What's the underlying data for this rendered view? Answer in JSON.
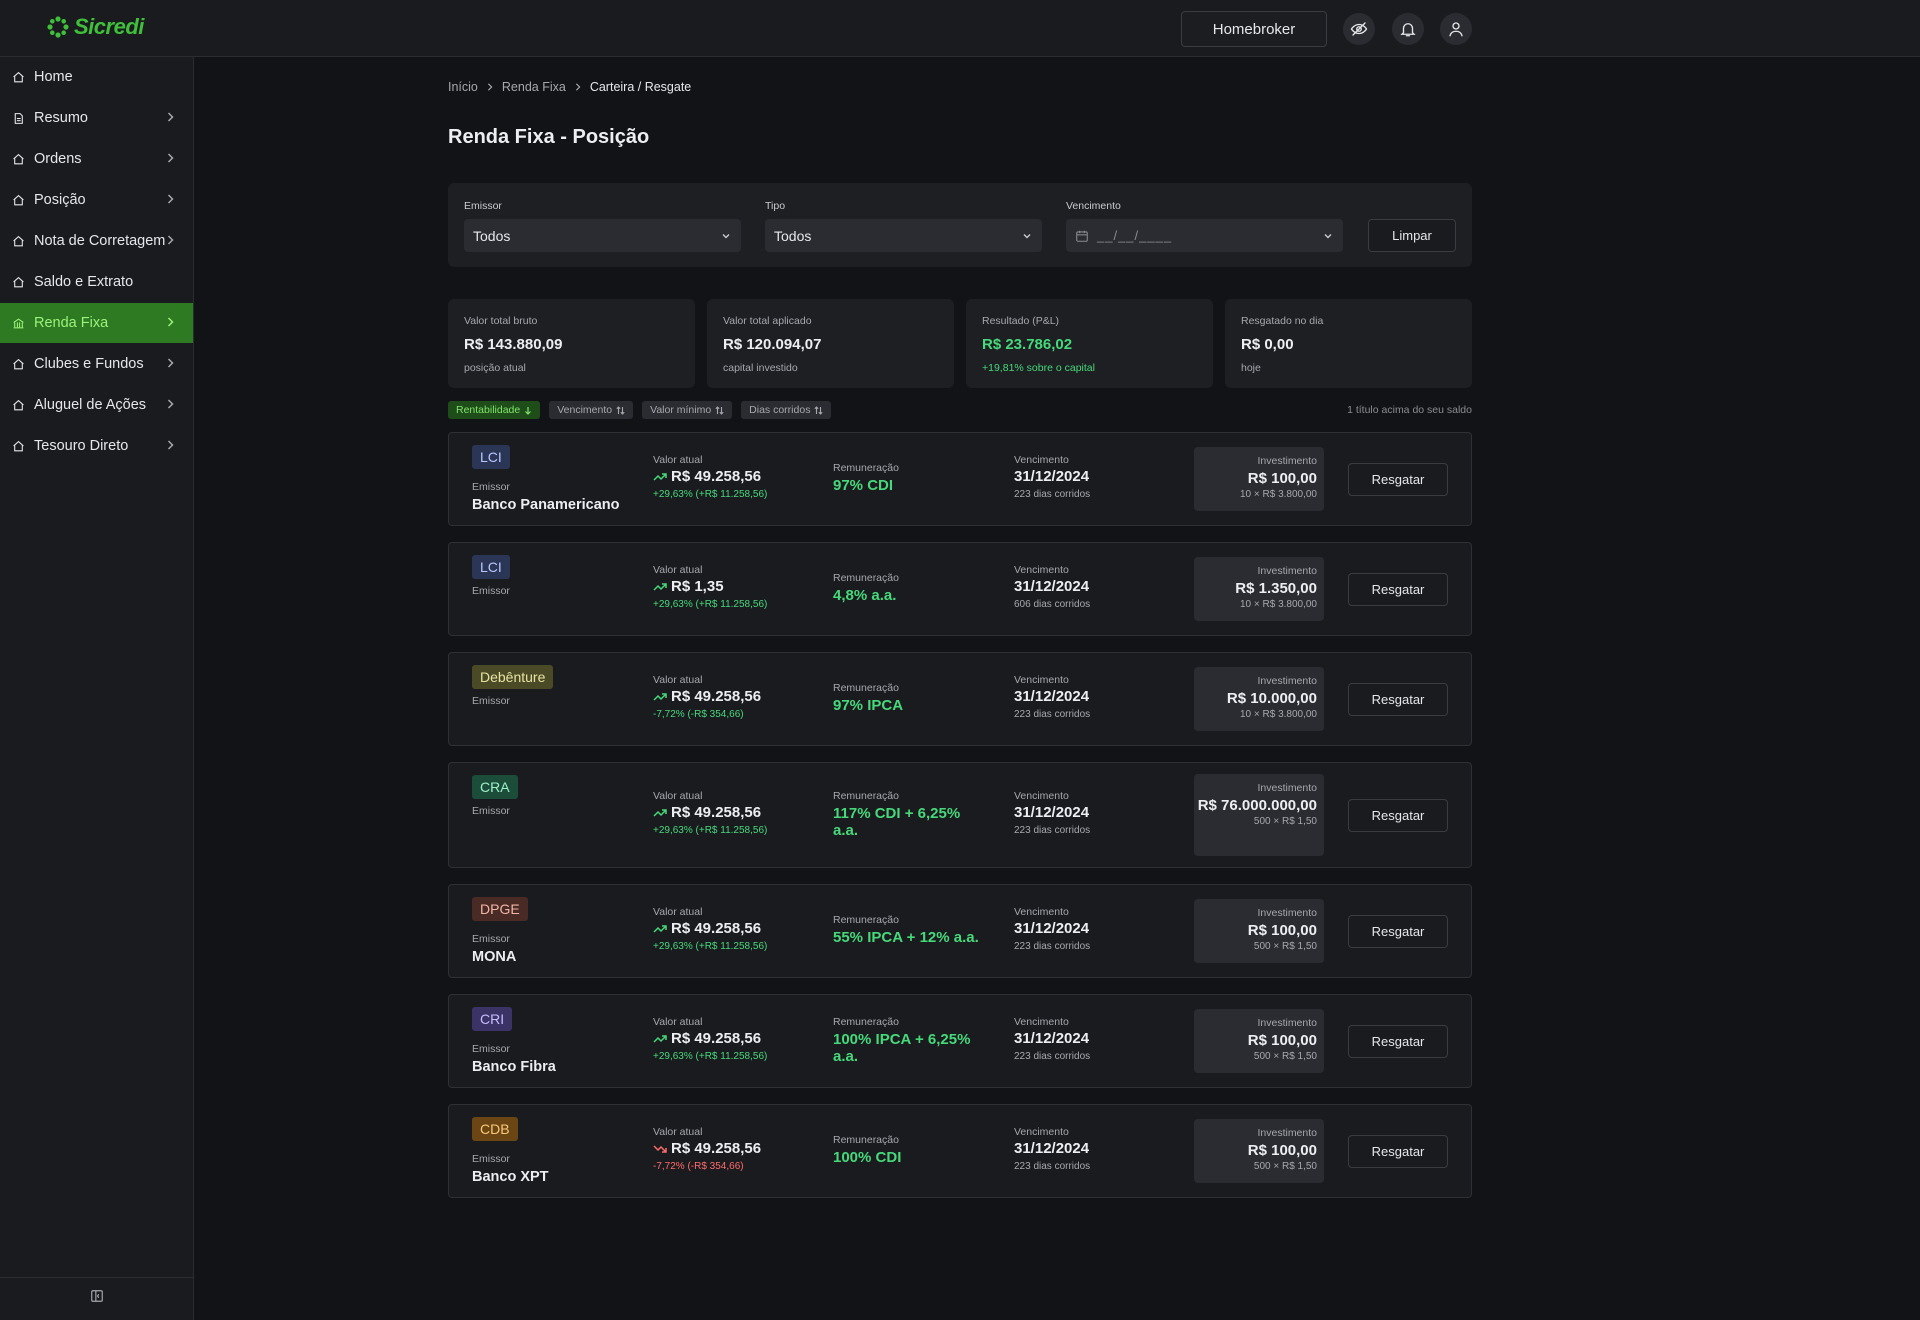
{
  "header": {
    "logo_text": "Sicredi",
    "homebroker_label": "Homebroker",
    "icons": [
      "eye-off-icon",
      "bell-icon",
      "user-icon"
    ]
  },
  "sidebar": {
    "items": [
      {
        "label": "Home",
        "has_chevron": false,
        "active": false,
        "icon": "home-icon"
      },
      {
        "label": "Resumo",
        "has_chevron": true,
        "active": false,
        "icon": "document-icon"
      },
      {
        "label": "Ordens",
        "has_chevron": true,
        "active": false,
        "icon": "home-icon"
      },
      {
        "label": "Posição",
        "has_chevron": true,
        "active": false,
        "icon": "home-icon"
      },
      {
        "label": "Nota de Corretagem",
        "has_chevron": true,
        "active": false,
        "icon": "home-icon"
      },
      {
        "label": "Saldo e Extrato",
        "has_chevron": false,
        "active": false,
        "icon": "home-icon"
      },
      {
        "label": "Renda Fixa",
        "has_chevron": true,
        "active": true,
        "icon": "bank-icon"
      },
      {
        "label": "Clubes e Fundos",
        "has_chevron": true,
        "active": false,
        "icon": "home-icon"
      },
      {
        "label": "Aluguel de Ações",
        "has_chevron": true,
        "active": false,
        "icon": "home-icon"
      },
      {
        "label": "Tesouro Direto",
        "has_chevron": true,
        "active": false,
        "icon": "home-icon"
      }
    ]
  },
  "breadcrumb": [
    "Início",
    "Renda Fixa",
    "Carteira / Resgate"
  ],
  "page_title": "Renda Fixa - Posição",
  "filters": {
    "emissor": {
      "label": "Emissor",
      "value": "Todos"
    },
    "tipo": {
      "label": "Tipo",
      "value": "Todos"
    },
    "vencimento": {
      "label": "Vencimento",
      "placeholder": "__/__/____"
    },
    "clear_label": "Limpar"
  },
  "stats": [
    {
      "label": "Valor total bruto",
      "value": "R$ 143.880,09",
      "sub": "posição atual",
      "positive": false
    },
    {
      "label": "Valor total aplicado",
      "value": "R$ 120.094,07",
      "sub": "capital investido",
      "positive": false
    },
    {
      "label": "Resultado (P&L)",
      "value": "R$ 23.786,02",
      "sub": "+19,81% sobre o capital",
      "positive": true
    },
    {
      "label": "Resgatado no dia",
      "value": "R$ 0,00",
      "sub": "hoje",
      "positive": false
    }
  ],
  "sort": {
    "chips": [
      {
        "label": "Rentabilidade",
        "active": true
      },
      {
        "label": "Vencimento",
        "active": false
      },
      {
        "label": "Valor mínimo",
        "active": false
      },
      {
        "label": "Dias corridos",
        "active": false
      }
    ],
    "note": "1 título acima do seu saldo"
  },
  "column_labels": {
    "emissor": "Emissor",
    "valor_atual": "Valor atual",
    "remuneracao": "Remuneração",
    "vencimento": "Vencimento",
    "investimento": "Investimento",
    "action": "Resgatar"
  },
  "positions": [
    {
      "type": "LCI",
      "type_class": "lci",
      "emissor": "Banco Panamericano",
      "valor": "R$ 49.258,56",
      "trend": "up",
      "change": "+29,63% (+R$ 11.258,56)",
      "remuneracao": "97% CDI",
      "vencimento": "31/12/2024",
      "dias": "223 dias corridos",
      "investimento": "R$ 100,00",
      "qty": "10 × R$ 3.800,00"
    },
    {
      "type": "LCI",
      "type_class": "lci",
      "emissor": "",
      "valor": "R$ 1,35",
      "trend": "up",
      "change": "+29,63% (+R$ 11.258,56)",
      "remuneracao": "4,8% a.a.",
      "vencimento": "31/12/2024",
      "dias": "606 dias corridos",
      "investimento": "R$ 1.350,00",
      "qty": "10 × R$ 3.800,00"
    },
    {
      "type": "Debênture",
      "type_class": "deb",
      "emissor": "",
      "valor": "R$ 49.258,56",
      "trend": "up",
      "change": "-7,72% (-R$ 354,66)",
      "change_color": "pos",
      "remuneracao": "97% IPCA",
      "vencimento": "31/12/2024",
      "dias": "223 dias corridos",
      "investimento": "R$ 10.000,00",
      "qty": "10 × R$ 3.800,00"
    },
    {
      "type": "CRA",
      "type_class": "cra",
      "emissor": "",
      "valor": "R$ 49.258,56",
      "trend": "up",
      "change": "+29,63% (+R$ 11.258,56)",
      "remuneracao": "117% CDI + 6,25% a.a.",
      "vencimento": "31/12/2024",
      "dias": "223 dias corridos",
      "investimento": "R$ 76.000.000,00",
      "qty": "500 × R$ 1,50"
    },
    {
      "type": "DPGE",
      "type_class": "dpge",
      "emissor": "MONA",
      "valor": "R$ 49.258,56",
      "trend": "up",
      "change": "+29,63% (+R$ 11.258,56)",
      "remuneracao": "55% IPCA + 12% a.a.",
      "vencimento": "31/12/2024",
      "dias": "223 dias corridos",
      "investimento": "R$ 100,00",
      "qty": "500 × R$ 1,50"
    },
    {
      "type": "CRI",
      "type_class": "cri",
      "emissor": "Banco Fibra",
      "valor": "R$ 49.258,56",
      "trend": "up",
      "change": "+29,63% (+R$ 11.258,56)",
      "remuneracao": "100% IPCA + 6,25% a.a.",
      "vencimento": "31/12/2024",
      "dias": "223 dias corridos",
      "investimento": "R$ 100,00",
      "qty": "500 × R$ 1,50"
    },
    {
      "type": "CDB",
      "type_class": "cdb",
      "emissor": "Banco XPT",
      "valor": "R$ 49.258,56",
      "trend": "down",
      "change": "-7,72% (-R$ 354,66)",
      "remuneracao": "100% CDI",
      "vencimento": "31/12/2024",
      "dias": "223 dias corridos",
      "investimento": "R$ 100,00",
      "qty": "500 × R$ 1,50"
    }
  ],
  "colors": {
    "accent": "#3fbf3a",
    "positive": "#46d97a",
    "negative": "#ff6b6b",
    "active_nav": "#2d7a23"
  }
}
